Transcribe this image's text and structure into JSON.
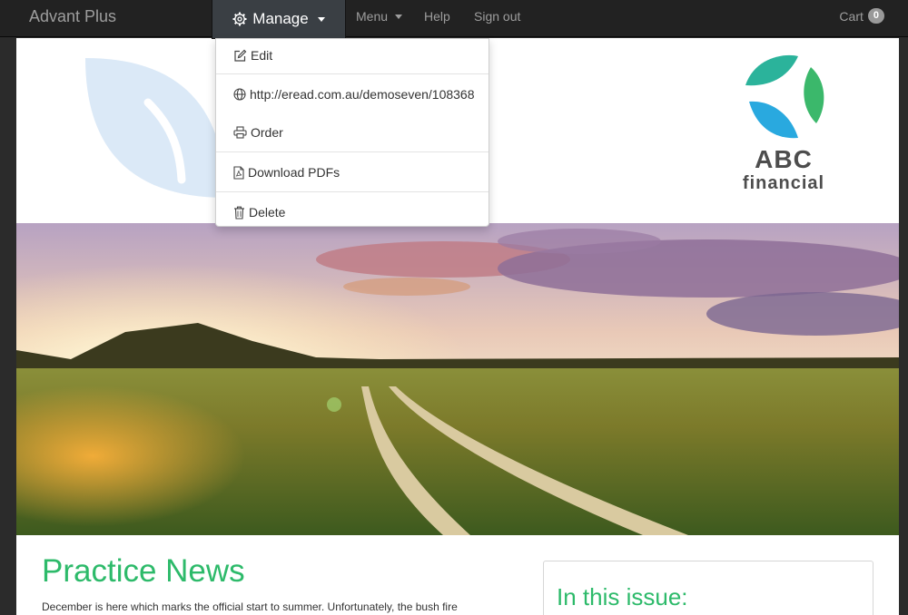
{
  "navbar": {
    "brand": "Advant Plus",
    "manage_label": "Manage",
    "menu_label": "Menu",
    "help_label": "Help",
    "signout_label": "Sign out",
    "cart_label": "Cart",
    "cart_count": "0"
  },
  "dropdown": {
    "items": [
      {
        "label": "Edit",
        "icon": "pencil-square-icon"
      },
      {
        "label": "http://eread.com.au/demoseven/108368",
        "icon": "globe-icon"
      },
      {
        "label": "Order",
        "icon": "printer-icon"
      },
      {
        "label": "Download PDFs",
        "icon": "pdf-file-icon"
      },
      {
        "label": "Delete",
        "icon": "trash-icon"
      }
    ]
  },
  "logo": {
    "line1": "ABC",
    "line2": "financial"
  },
  "content": {
    "headline": "Practice News",
    "intro": "December is here which marks the official start to summer. Unfortunately, the bush fire",
    "sidebar_title": "In this issue:"
  },
  "colors": {
    "accent_green": "#2dba6a",
    "navbar_bg": "#222222",
    "logo_teal": "#2bb39b",
    "logo_blue": "#29a9df",
    "logo_green": "#3bb86b"
  }
}
